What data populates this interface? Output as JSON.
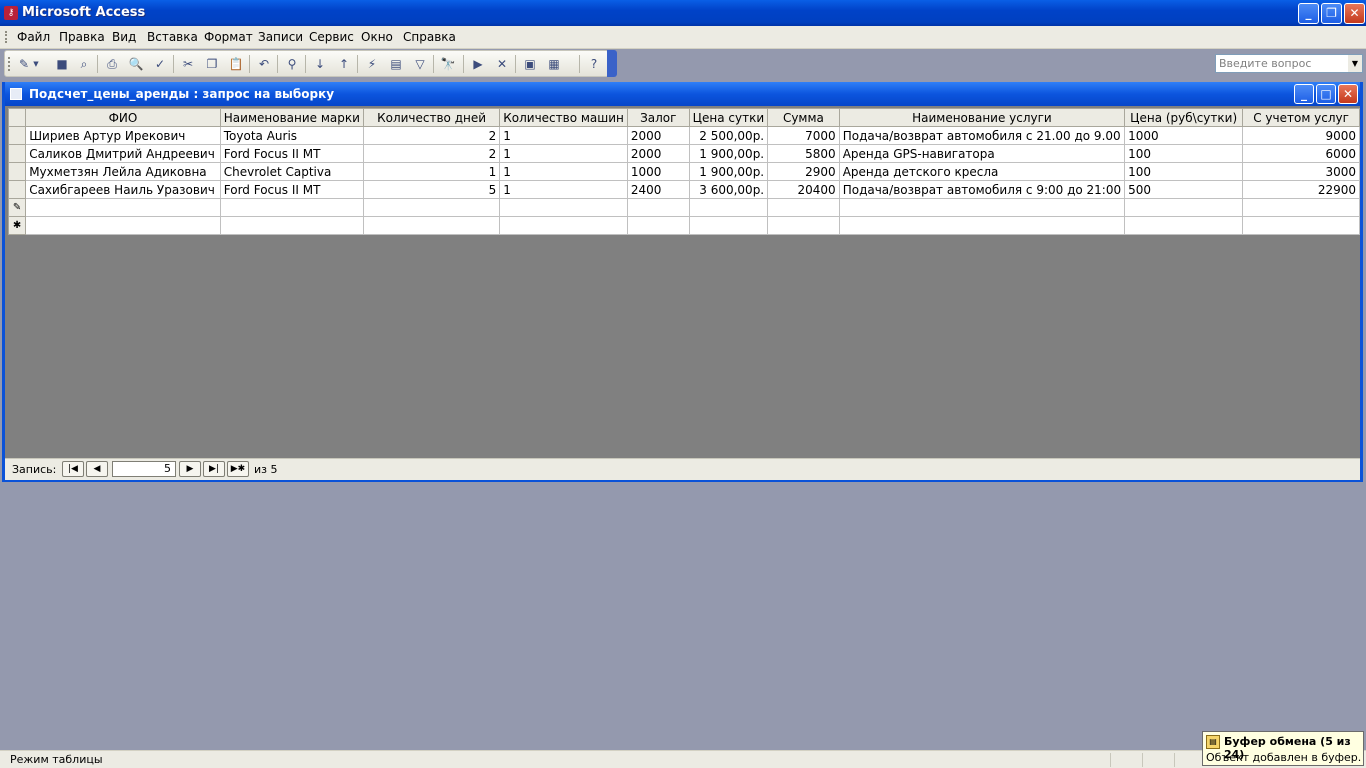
{
  "app": {
    "title": "Microsoft Access",
    "icon": "access-key-icon"
  },
  "menu": {
    "items": [
      "Файл",
      "Правка",
      "Вид",
      "Вставка",
      "Формат",
      "Записи",
      "Сервис",
      "Окно",
      "Справка"
    ],
    "ask_placeholder": "Введите вопрос"
  },
  "toolbar": {
    "buttons": [
      {
        "name": "view-icon",
        "glyph": "✎"
      },
      {
        "name": "save-icon",
        "glyph": "■"
      },
      {
        "name": "search-file-icon",
        "glyph": "⌕"
      },
      {
        "name": "print-icon",
        "glyph": "⎙"
      },
      {
        "name": "print-preview-icon",
        "glyph": "🔍"
      },
      {
        "name": "spelling-icon",
        "glyph": "✓"
      },
      {
        "name": "cut-icon",
        "glyph": "✂"
      },
      {
        "name": "copy-icon",
        "glyph": "❐"
      },
      {
        "name": "paste-icon",
        "glyph": "📋"
      },
      {
        "name": "undo-icon",
        "glyph": "↶"
      },
      {
        "name": "hyperlink-icon",
        "glyph": "⚲"
      },
      {
        "name": "sort-ascending-icon",
        "glyph": "↓"
      },
      {
        "name": "sort-descending-icon",
        "glyph": "↑"
      },
      {
        "name": "filter-by-selection-icon",
        "glyph": "⚡"
      },
      {
        "name": "filter-by-form-icon",
        "glyph": "▤"
      },
      {
        "name": "apply-filter-icon",
        "glyph": "▽"
      },
      {
        "name": "find-icon",
        "glyph": "🔭"
      },
      {
        "name": "new-record-icon",
        "glyph": "▶"
      },
      {
        "name": "delete-record-icon",
        "glyph": "✕"
      },
      {
        "name": "database-window-icon",
        "glyph": "▣"
      },
      {
        "name": "new-object-icon",
        "glyph": "▦"
      },
      {
        "name": "help-icon",
        "glyph": "?"
      }
    ]
  },
  "query_window": {
    "title": "Подсчет_цены_аренды : запрос на выборку",
    "columns": [
      "ФИО",
      "Наименование марки",
      "Количество дней",
      "Количество машин",
      "Залог",
      "Цена сутки",
      "Сумма",
      "Наименование услуги",
      "Цена (руб\\сутки)",
      "С учетом услуг"
    ],
    "rows": [
      [
        "Шириев Артур Ирекович",
        "Toyota Auris",
        "2",
        "1",
        "2000",
        "2 500,00р.",
        "7000",
        "Подача/возврат автомобиля с 21.00 до 9.00",
        "1000",
        "9000"
      ],
      [
        "Саликов Дмитрий Андреевич",
        "Ford Focus II MT",
        "2",
        "1",
        "2000",
        "1 900,00р.",
        "5800",
        "Аренда GPS-навигатора",
        "100",
        "6000"
      ],
      [
        "Мухметзян Лейла Адиковна",
        "Chevrolet Captiva",
        "1",
        "1",
        "1000",
        "1 900,00р.",
        "2900",
        "Аренда детского кресла",
        "100",
        "3000"
      ],
      [
        "Сахибгареев Наиль Уразович",
        "Ford Focus II MT",
        "5",
        "1",
        "2400",
        "3 600,00р.",
        "20400",
        "Подача/возврат автомобиля с 9:00 до 21:00",
        "500",
        "22900"
      ]
    ],
    "edit_marker": "✎",
    "new_marker": "✱"
  },
  "navigator": {
    "label": "Запись:",
    "current": "5",
    "of_text": "из  5"
  },
  "status": {
    "text": "Режим таблицы"
  },
  "clipboard": {
    "title": "Буфер обмена (5 из 24)",
    "text": "Объект добавлен в буфер."
  }
}
